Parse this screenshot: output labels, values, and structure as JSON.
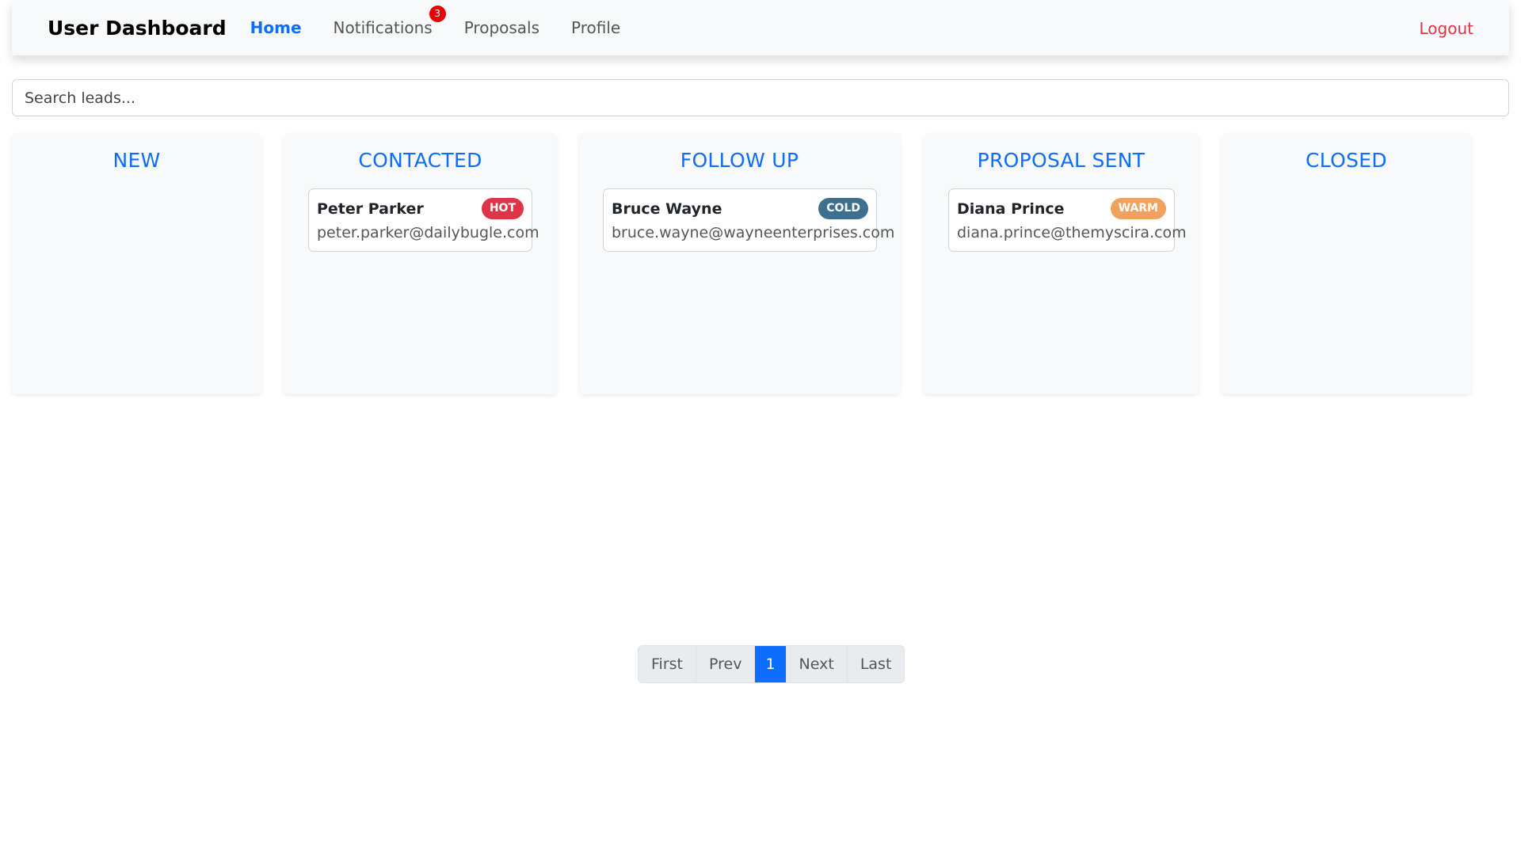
{
  "navbar": {
    "brand": "User Dashboard",
    "links": [
      {
        "label": "Home",
        "active": true
      },
      {
        "label": "Notifications",
        "badge": "3"
      },
      {
        "label": "Proposals"
      },
      {
        "label": "Profile"
      }
    ],
    "logout": "Logout"
  },
  "search": {
    "placeholder": "Search leads..."
  },
  "board": {
    "columns": [
      {
        "title": "NEW",
        "leads": []
      },
      {
        "title": "CONTACTED",
        "leads": [
          {
            "name": "Peter Parker",
            "email": "peter.parker@dailybugle.com",
            "priority": "HOT",
            "priority_color": "#dc3545"
          }
        ]
      },
      {
        "title": "FOLLOW UP",
        "leads": [
          {
            "name": "Bruce Wayne",
            "email": "bruce.wayne@wayneenterprises.com",
            "priority": "COLD",
            "priority_color": "#3f6f8f"
          }
        ]
      },
      {
        "title": "PROPOSAL SENT",
        "leads": [
          {
            "name": "Diana Prince",
            "email": "diana.prince@themyscira.com",
            "priority": "WARM",
            "priority_color": "#f0a15e"
          }
        ]
      },
      {
        "title": "CLOSED",
        "leads": []
      }
    ]
  },
  "pagination": {
    "first": "First",
    "prev": "Prev",
    "current": "1",
    "next": "Next",
    "last": "Last"
  },
  "colors": {
    "accent": "#0d6efd",
    "danger": "#dc3545",
    "notification_badge": "#e60000"
  }
}
